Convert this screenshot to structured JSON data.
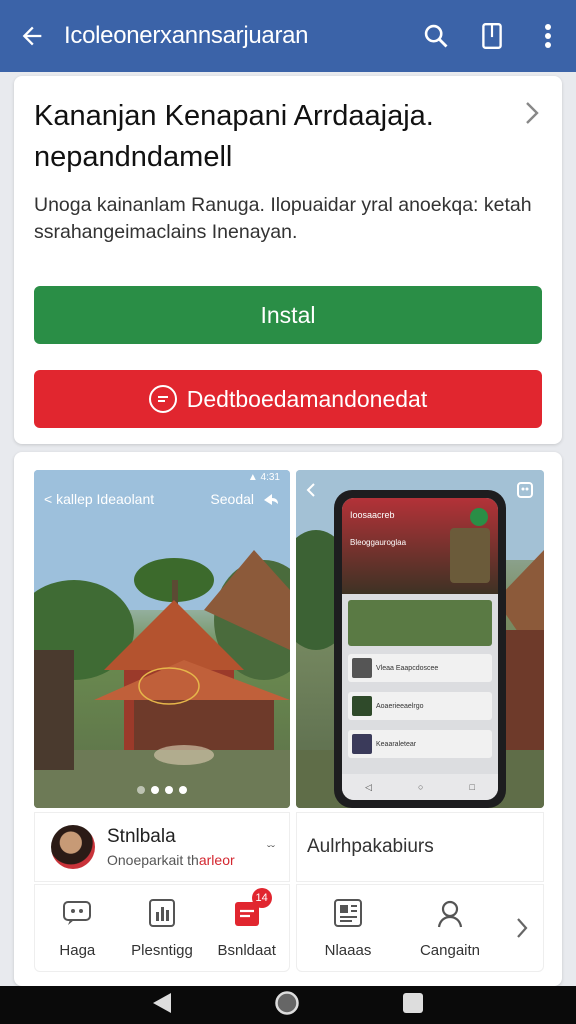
{
  "app_bar": {
    "title": "Icoleonerxannsarjuaran",
    "icons": [
      "back-arrow-icon",
      "search-icon",
      "bookmark-icon",
      "more-vert-icon"
    ],
    "color": "#3b63a8"
  },
  "app_card": {
    "title": "Kananjan Kenapani Arrdaajaja. nepandndamell",
    "description": "Unoga kainanlam Ranuga. Ilopuaidar yral anoekqa: ketah ssrahangeimaclains Inenayan.",
    "install_label": "Instal",
    "download_label": "Dedtboedamandonedat",
    "install_color": "#2a8e46",
    "download_color": "#e1262f"
  },
  "screenshots": {
    "shot1": {
      "back_label": "< kallep Ideaolant",
      "right_label": "Seodal",
      "status": "▲ 4:31"
    },
    "shot2": {
      "screen_title": "Ioosaacreb",
      "screen_sub": "Bleoggauroglaa",
      "rows": [
        "Vleaa Eaapcdoscee",
        "Aoaerieeaelrgo",
        "Keaaraletear"
      ]
    }
  },
  "info": {
    "left_name": "Stnlbala",
    "left_sub_prefix": "Onoeparkait th",
    "left_sub_red": "arleor",
    "left_tiny": "ˇˇ",
    "right_text": "Aulrhpakabiurs"
  },
  "tabs_left": [
    {
      "label": "Haga",
      "icon": "chat-icon"
    },
    {
      "label": "Plesntigg",
      "icon": "chart-icon"
    },
    {
      "label": "Bsnldaat",
      "icon": "inbox-icon",
      "badge": "14"
    }
  ],
  "tabs_right": [
    {
      "label": "Nlaaas",
      "icon": "news-icon"
    },
    {
      "label": "Cangaitn",
      "icon": "person-icon"
    }
  ]
}
